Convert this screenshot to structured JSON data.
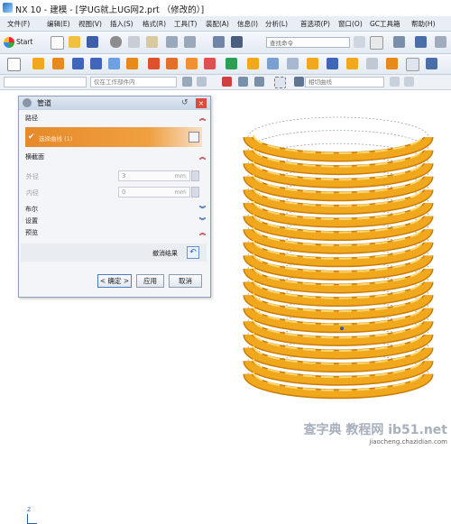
{
  "window": {
    "title": "NX 10 - 建模 - [学UG就上UG网2.prt （修改的）]",
    "menu": [
      "文件(F)",
      "编辑(E)",
      "视图(V)",
      "插入(S)",
      "格式(R)",
      "工具(T)",
      "装配(A)",
      "信息(I)",
      "分析(L)",
      "首选项(P)",
      "窗口(O)",
      "GC工具箱",
      "帮助(H)"
    ]
  },
  "toolbar": {
    "start_label": "Start",
    "search_placeholder": "查找命令",
    "filter_scope": "仅在工作部件内",
    "curve_rule": "相切曲线"
  },
  "dialog": {
    "title": "管道",
    "sections": {
      "path": "路径",
      "path_item": "选择曲线 (1)",
      "cross_section": "横截面",
      "boolean": "布尔",
      "settings": "设置",
      "preview": "预览"
    },
    "outer_label": "外径",
    "outer_value": "3",
    "inner_label": "内径",
    "inner_value": "0",
    "unit": "mm",
    "undo_label": "撤消结果",
    "ok": "< 确定 >",
    "apply": "应用",
    "cancel": "取消"
  },
  "watermark": {
    "line1": "查字典 教程网 ib51.net",
    "line2": "jiaocheng.chazidian.com"
  },
  "colors": {
    "coil": "#f2a81d",
    "coil_dark": "#c97d08",
    "arrow": "#e23b3b"
  }
}
